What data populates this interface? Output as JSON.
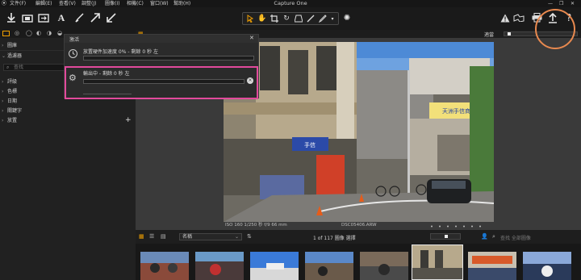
{
  "app": {
    "title": "Capture One"
  },
  "menu": [
    "文件(F)",
    "編輯(E)",
    "查看(V)",
    "調整(J)",
    "圖像(I)",
    "相機(C)",
    "窗口(W)",
    "幫助(H)"
  ],
  "left_panel": {
    "sections": [
      {
        "label": "圖庫"
      },
      {
        "label": "過濾器"
      }
    ],
    "search_placeholder": "查找",
    "filters": [
      "評級",
      "色標",
      "日期",
      "關鍵字",
      "放置"
    ]
  },
  "activity": {
    "title": "激活",
    "task1": "放置硬件加速度 0% - 剩餘 0 秒 左",
    "task2": "輸出中 - 剩餘 0 秒 左",
    "task1_progress": 0,
    "task2_progress": 0
  },
  "viewer": {
    "label": "適當",
    "caption_left": "ISO 160  1/250 秒  f/9  66 mm",
    "caption_center": "DSC05406.ARW",
    "photo_signs": {
      "blue_sign": "天洲手信商店",
      "red_sign": "手信"
    }
  },
  "browser": {
    "sort_value": "名稱",
    "count_text": "1 of 117 圖像 選擇",
    "search_placeholder": "查找 全部圖像"
  },
  "colors": {
    "highlight_box": "#e24a9c",
    "annotation_circle": "#e8894f",
    "accent": "#f2a000"
  }
}
